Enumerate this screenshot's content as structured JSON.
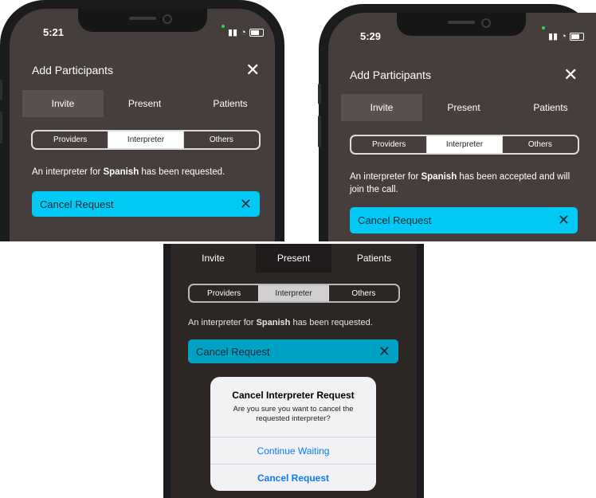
{
  "screens": [
    {
      "time": "5:21",
      "title": "Add Participants",
      "tabs": [
        {
          "label": "Invite"
        },
        {
          "label": "Present"
        },
        {
          "label": "Patients"
        }
      ],
      "active_tab": "Invite",
      "segments": [
        {
          "label": "Providers"
        },
        {
          "label": "Interpreter"
        },
        {
          "label": "Others"
        }
      ],
      "active_segment": "Interpreter",
      "message": {
        "prefix": "An interpreter for ",
        "language": "Spanish",
        "suffix": " has been requested."
      },
      "cancel_label": "Cancel Request"
    },
    {
      "time": "5:29",
      "title": "Add Participants",
      "tabs": [
        {
          "label": "Invite"
        },
        {
          "label": "Present"
        },
        {
          "label": "Patients"
        }
      ],
      "active_tab": "Invite",
      "segments": [
        {
          "label": "Providers"
        },
        {
          "label": "Interpreter"
        },
        {
          "label": "Others"
        }
      ],
      "active_segment": "Interpreter",
      "message": {
        "prefix": "An interpreter for ",
        "language": "Spanish",
        "suffix": " has been accepted and will join the call."
      },
      "cancel_label": "Cancel Request"
    },
    {
      "tabs": [
        {
          "label": "Invite"
        },
        {
          "label": "Present"
        },
        {
          "label": "Patients"
        }
      ],
      "active_tab": "Present",
      "segments": [
        {
          "label": "Providers"
        },
        {
          "label": "Interpreter"
        },
        {
          "label": "Others"
        }
      ],
      "active_segment": "Interpreter",
      "message": {
        "prefix": "An interpreter for ",
        "language": "Spanish",
        "suffix": " has been requested."
      },
      "cancel_label": "Cancel Request",
      "dialog": {
        "title": "Cancel Interpreter Request",
        "body": "Are you sure you want to cancel the requested interpreter?",
        "continue_label": "Continue Waiting",
        "cancel_label": "Cancel Request"
      }
    }
  ],
  "colors": {
    "screen_bg": "#463e3c",
    "accent": "#00c9f5",
    "dialog_link": "#0a7bf2"
  },
  "icons": {
    "close": "close-icon",
    "wifi": "wifi-icon",
    "battery": "battery-icon"
  }
}
